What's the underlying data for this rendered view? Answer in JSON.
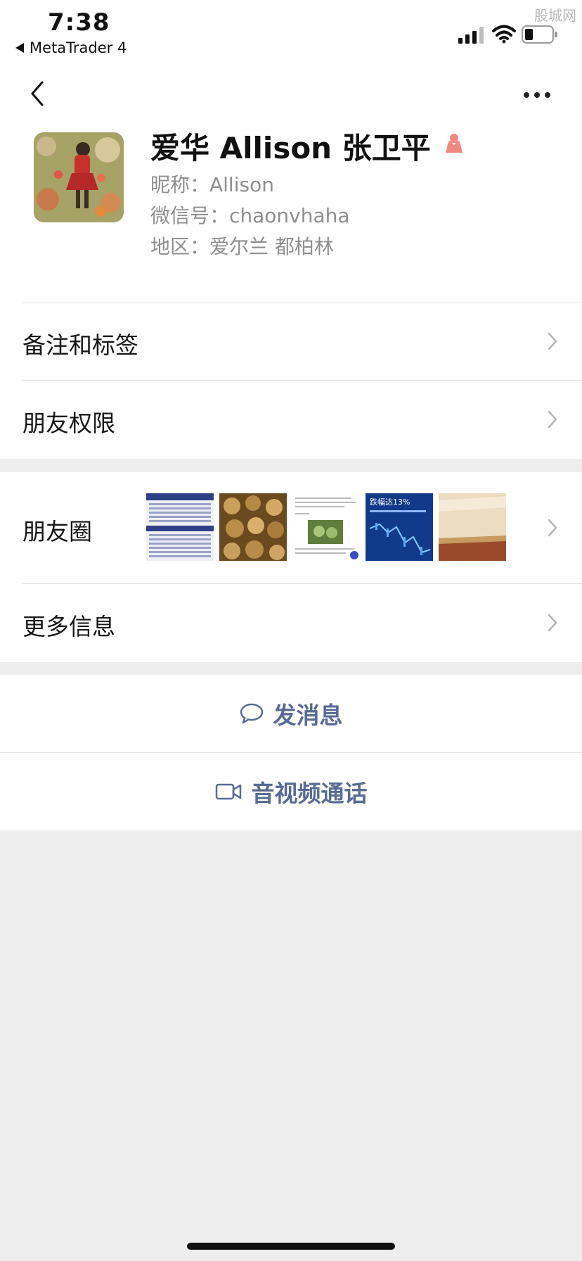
{
  "status": {
    "time": "7:38",
    "back_app": "MetaTrader 4",
    "watermark": "股城网"
  },
  "profile": {
    "display_name": "爱华  Allison 张卫平",
    "nickname_line": "昵称：Allison",
    "wechat_id_line": "微信号：chaonvhaha",
    "region_line": "地区：爱尔兰 都柏林",
    "gender_color": "#f08a80"
  },
  "rows": {
    "remarks_tags": "备注和标签",
    "friend_permissions": "朋友权限",
    "moments": "朋友圈",
    "more_info": "更多信息"
  },
  "moments_thumbs": {
    "thumb4_text": "跌幅达13%"
  },
  "actions": {
    "send_message": "发消息",
    "av_call": "音视频通话"
  },
  "colors": {
    "link_blue": "#576b95",
    "bg_gray": "#ededed"
  }
}
